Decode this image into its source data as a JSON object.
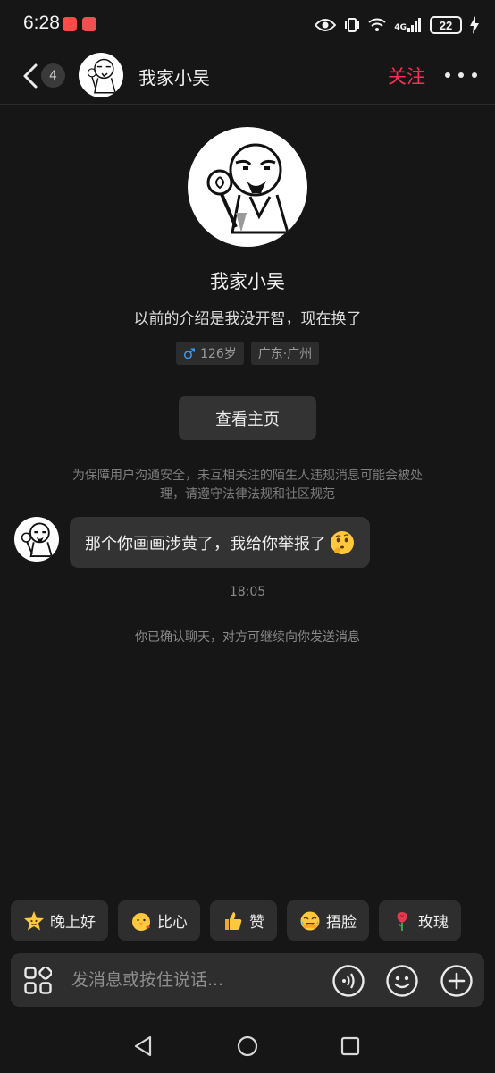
{
  "status_bar": {
    "time": "6:28",
    "network": "4G",
    "battery": "22"
  },
  "header": {
    "unread_count": "4",
    "contact_name": "我家小吴",
    "follow_label": "关注"
  },
  "profile": {
    "name": "我家小吴",
    "bio": "以前的介绍是我没开智，现在换了",
    "gender_symbol": "♂",
    "age": "126岁",
    "location": "广东·广州",
    "homepage_button": "查看主页"
  },
  "chat": {
    "safety_notice": "为保障用户沟通安全，未互相关注的陌生人违规消息可能会被处理，请遵守法律法规和社区规范",
    "message_text": "那个你画画涉黄了，我给你举报了",
    "message_emoji": "thinking-face",
    "time": "18:05",
    "system_message": "你已确认聊天，对方可继续向你发送消息"
  },
  "quick_replies": [
    {
      "label": "晚上好",
      "emoji": "star-face"
    },
    {
      "label": "比心",
      "emoji": "finger-heart-chick"
    },
    {
      "label": "赞",
      "emoji": "thumbs-up"
    },
    {
      "label": "捂脸",
      "emoji": "facepalm-laugh"
    },
    {
      "label": "玫瑰",
      "emoji": "rose"
    }
  ],
  "input": {
    "placeholder": "发消息或按住说话..."
  },
  "colors": {
    "background": "#161616",
    "accent_follow": "#fe2c55",
    "bubble": "#333333",
    "gender_blue": "#3aa0ff"
  }
}
